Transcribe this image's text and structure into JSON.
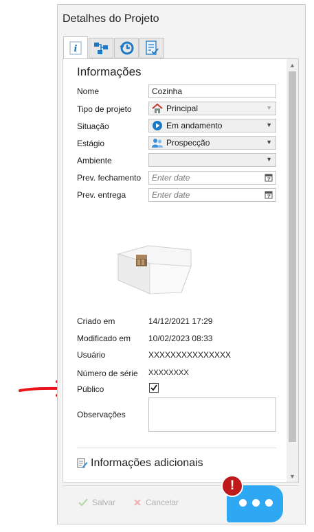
{
  "panel": {
    "title": "Detalhes do Projeto"
  },
  "tabs": [
    {
      "name": "info",
      "icon": "info-icon"
    },
    {
      "name": "structure",
      "icon": "hierarchy-icon"
    },
    {
      "name": "history",
      "icon": "history-icon"
    },
    {
      "name": "checklist",
      "icon": "checklist-icon"
    }
  ],
  "section": {
    "title": "Informações"
  },
  "fields": {
    "nome": {
      "label": "Nome",
      "value": "Cozinha"
    },
    "tipo": {
      "label": "Tipo de projeto",
      "value": "Principal",
      "icon": "house-icon"
    },
    "situacao": {
      "label": "Situação",
      "value": "Em andamento",
      "icon": "play-icon"
    },
    "estagio": {
      "label": "Estágio",
      "value": "Prospecção",
      "icon": "people-icon"
    },
    "ambiente": {
      "label": "Ambiente",
      "value": ""
    },
    "fechamento": {
      "label": "Prev. fechamento",
      "placeholder": "Enter date"
    },
    "entrega": {
      "label": "Prev. entrega",
      "placeholder": "Enter date"
    }
  },
  "info": {
    "criado": {
      "label": "Criado em",
      "value": "14/12/2021 17:29"
    },
    "modificado": {
      "label": "Modificado em",
      "value": "10/02/2023 08:33"
    },
    "usuario": {
      "label": "Usuário",
      "value": "XXXXXXXXXXXXXXX"
    },
    "serie": {
      "label": "Número de série",
      "value": "XXXXXXXX"
    },
    "publico": {
      "label": "Público",
      "checked": true
    },
    "observacoes": {
      "label": "Observações",
      "value": ""
    }
  },
  "additional": {
    "label": "Informações adicionais"
  },
  "footer": {
    "save": "Salvar",
    "cancel": "Cancelar"
  },
  "chat": {
    "badge": "!"
  },
  "colors": {
    "accent": "#2ea8f2",
    "alert": "#c0191c",
    "arrow": "#e8141b"
  }
}
